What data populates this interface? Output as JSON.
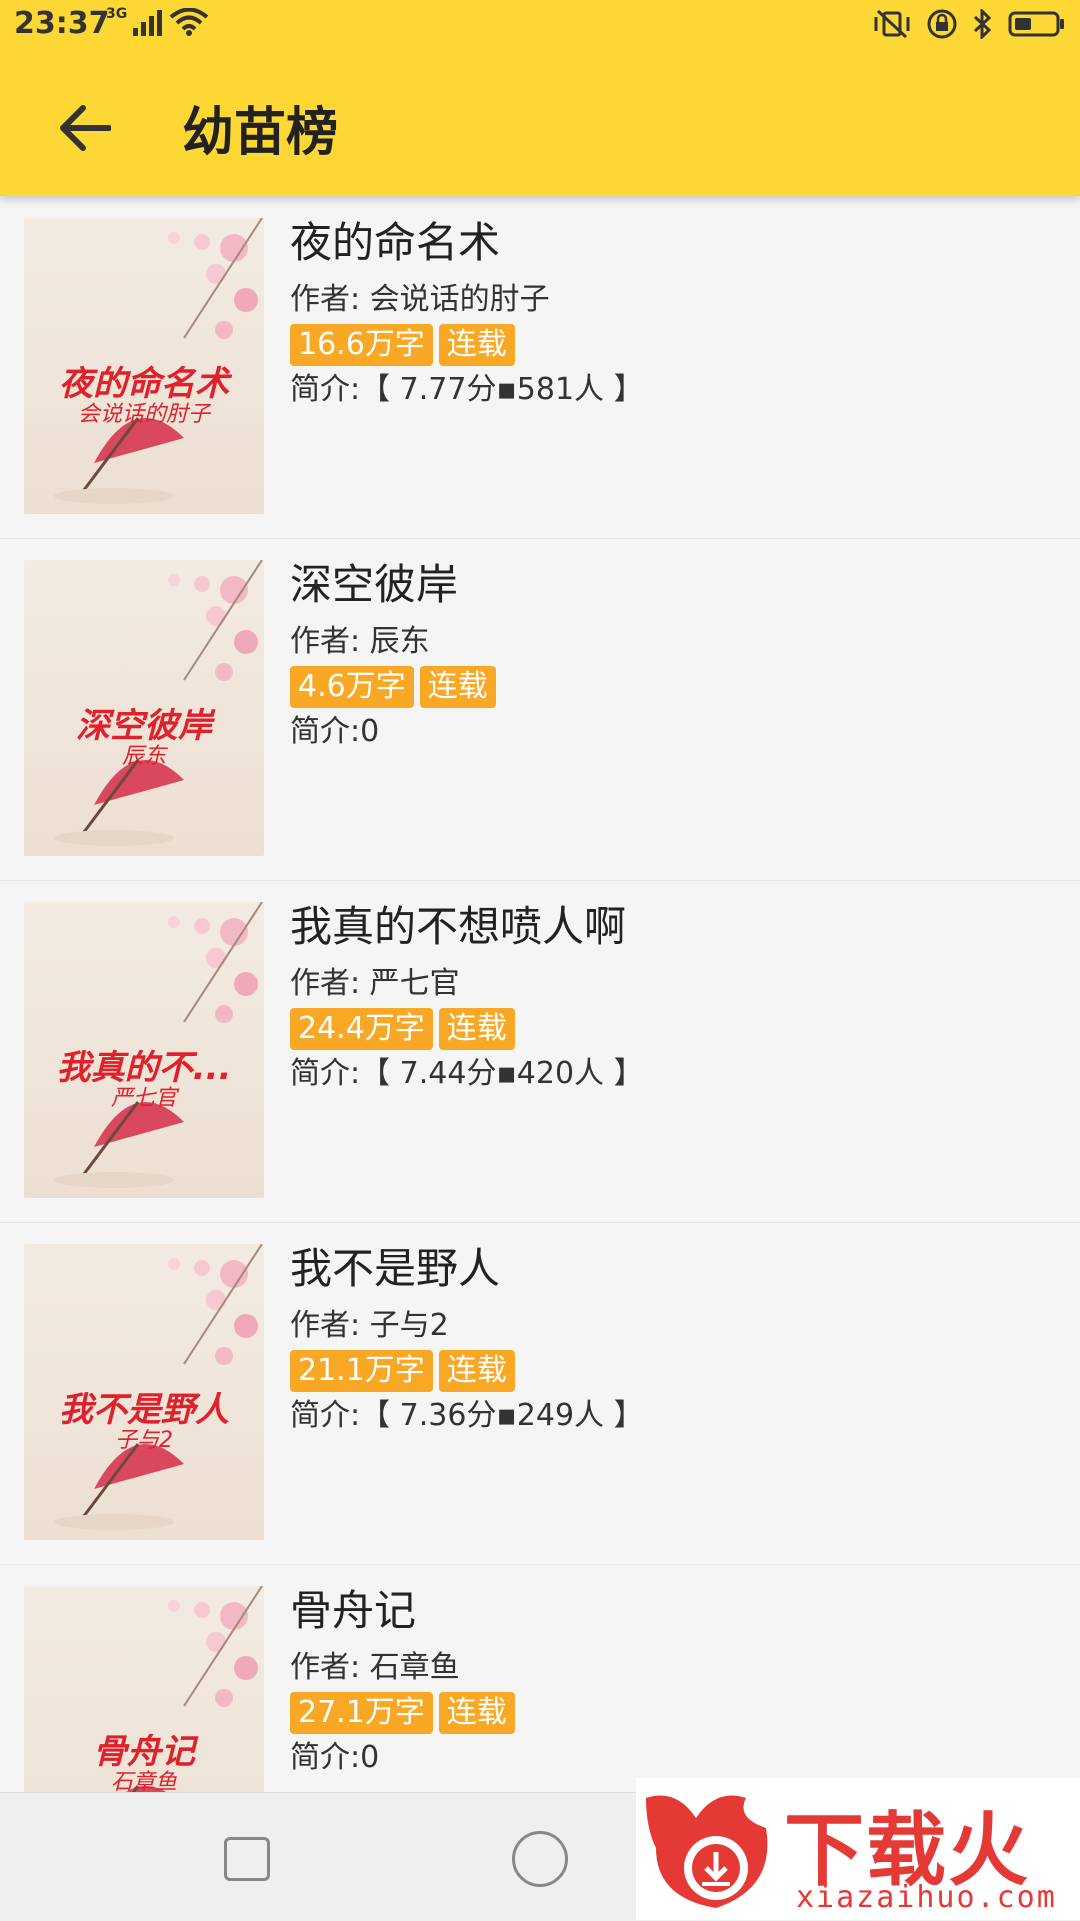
{
  "status": {
    "time": "23:37",
    "network": "3G"
  },
  "header": {
    "title": "幼苗榜"
  },
  "books": [
    {
      "cover_title": "夜的命名术",
      "cover_author": "会说话的肘子",
      "title": "夜的命名术",
      "author": "作者: 会说话的肘子",
      "words": "16.6万字",
      "status": "连载",
      "intro": "简介:【 7.77分▪581人 】"
    },
    {
      "cover_title": "深空彼岸",
      "cover_author": "辰东",
      "title": "深空彼岸",
      "author": "作者: 辰东",
      "words": "4.6万字",
      "status": "连载",
      "intro": "简介:0"
    },
    {
      "cover_title": "我真的不...",
      "cover_author": "严七官",
      "title": "我真的不想喷人啊",
      "author": "作者: 严七官",
      "words": "24.4万字",
      "status": "连载",
      "intro": "简介:【 7.44分▪420人 】"
    },
    {
      "cover_title": "我不是野人",
      "cover_author": "子与2",
      "title": "我不是野人",
      "author": "作者: 子与2",
      "words": "21.1万字",
      "status": "连载",
      "intro": "简介:【 7.36分▪249人 】"
    },
    {
      "cover_title": "骨舟记",
      "cover_author": "石章鱼",
      "title": "骨舟记",
      "author": "作者: 石章鱼",
      "words": "27.1万字",
      "status": "连载",
      "intro": "简介:0"
    }
  ],
  "watermark": {
    "text_cn": "下载火",
    "text_en": "xiazaihuo.com"
  },
  "colors": {
    "appbar": "#fdd835",
    "tag": "#f9a825",
    "cover_text": "#e0202a",
    "watermark": "#e53935"
  }
}
